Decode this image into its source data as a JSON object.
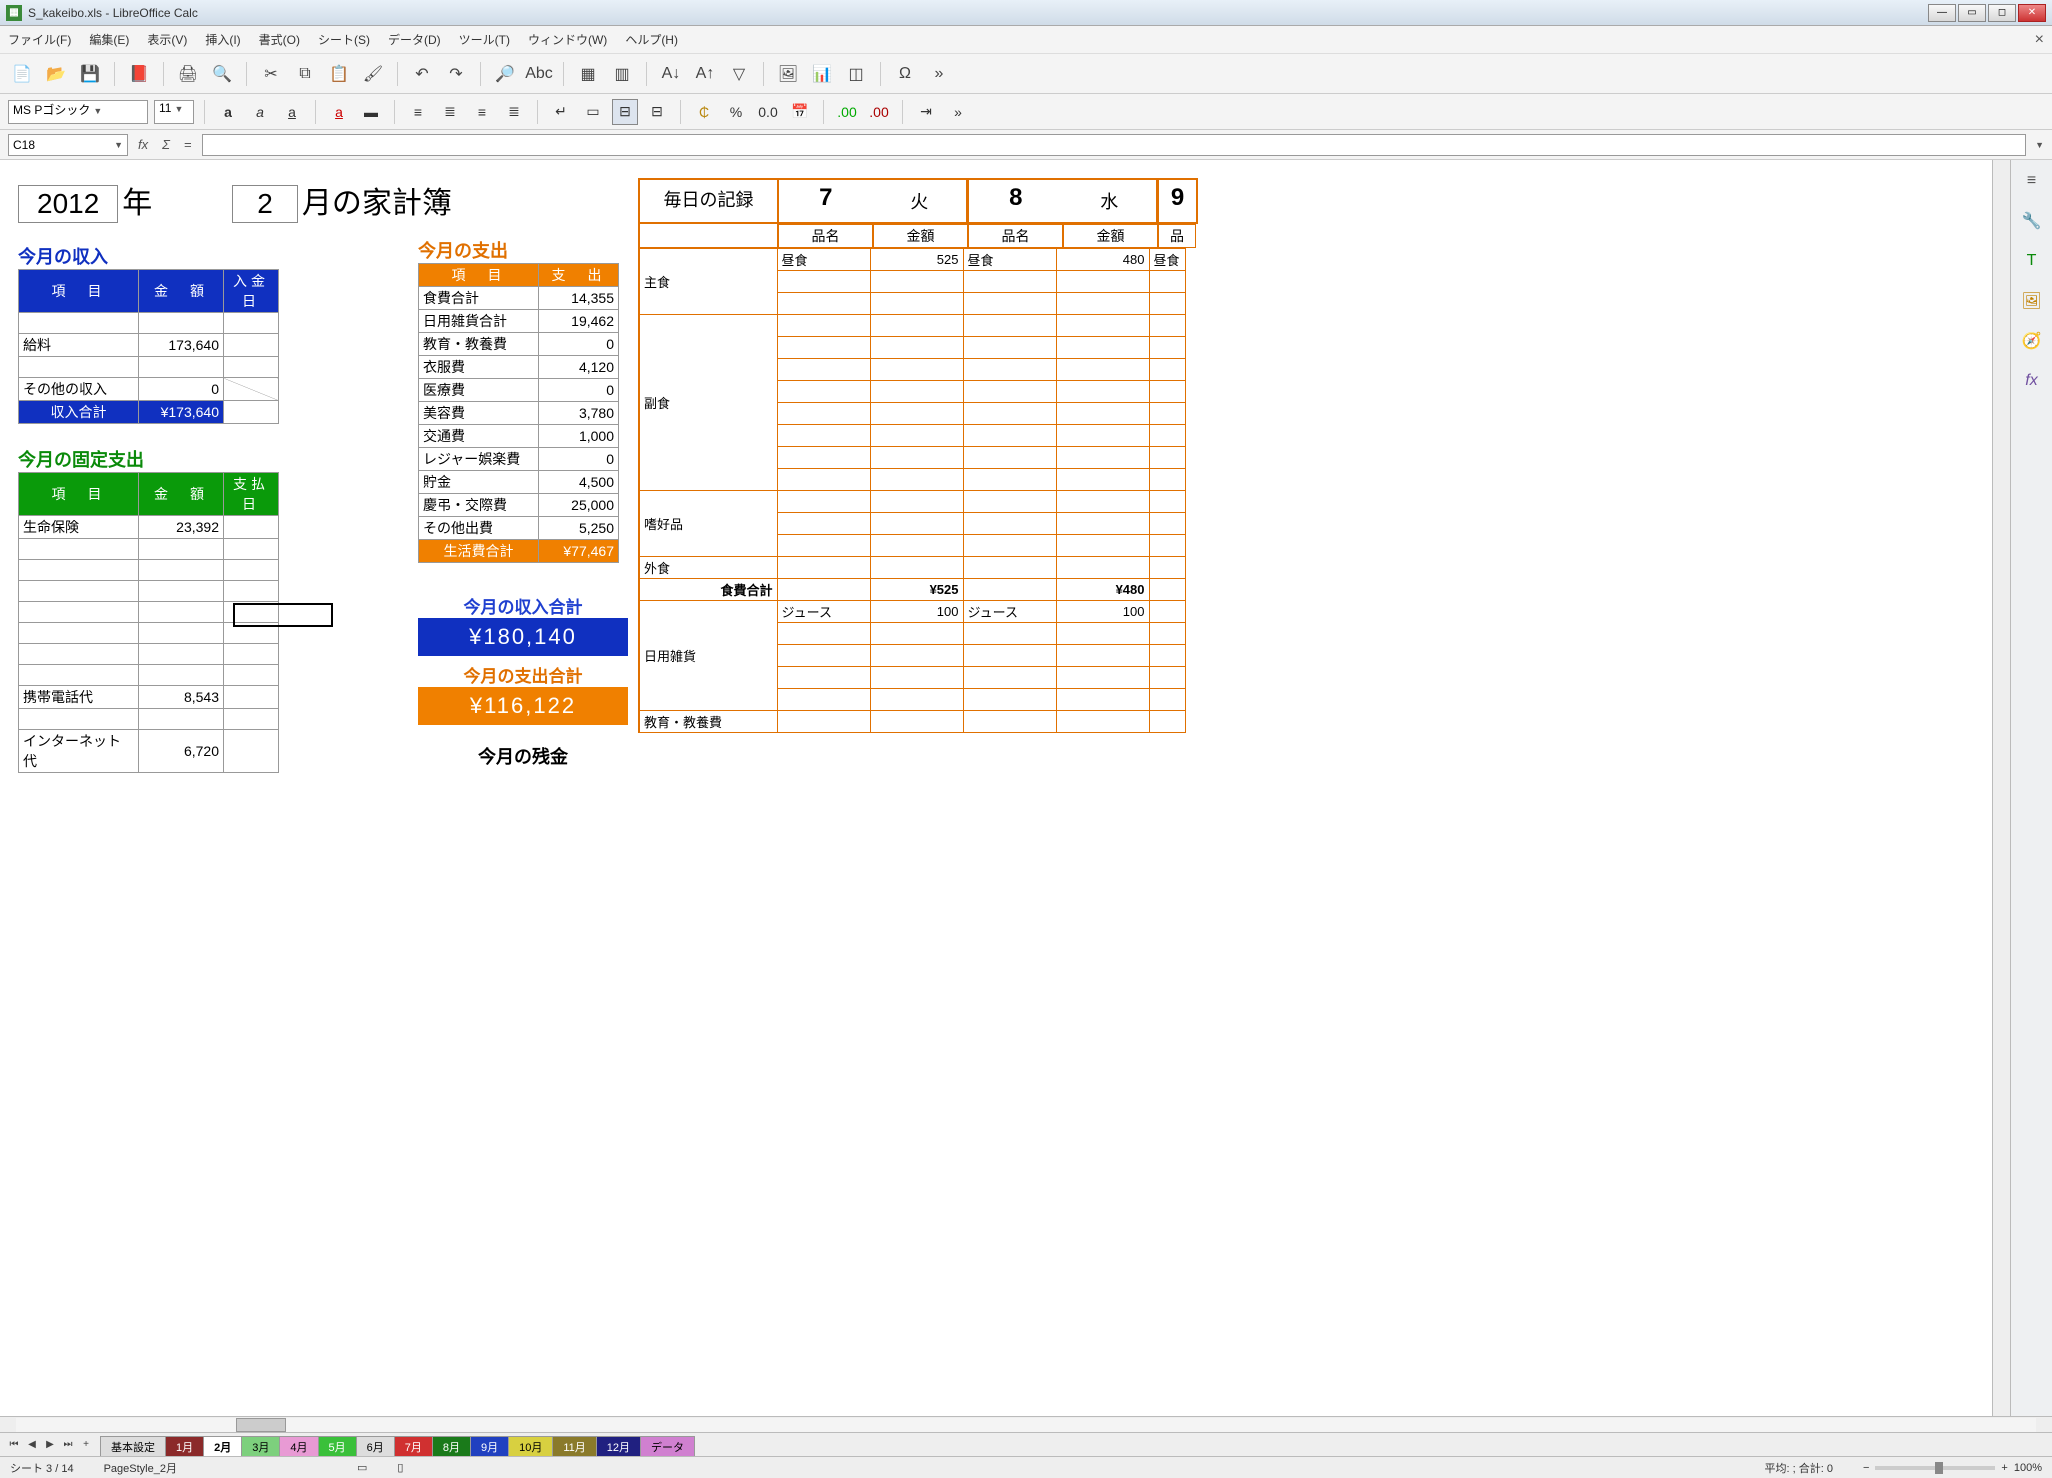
{
  "window": {
    "title": "S_kakeibo.xls - LibreOffice Calc"
  },
  "menu": {
    "file": "ファイル(F)",
    "edit": "編集(E)",
    "view": "表示(V)",
    "insert": "挿入(I)",
    "format": "書式(O)",
    "sheet": "シート(S)",
    "data": "データ(D)",
    "tools": "ツール(T)",
    "window": "ウィンドウ(W)",
    "help": "ヘルプ(H)"
  },
  "format_bar": {
    "font_name": "MS Pゴシック",
    "font_size": "11",
    "percent": "%",
    "decimal": "0.0"
  },
  "cell_ref": "C18",
  "doc": {
    "year": "2012",
    "year_suffix": "年",
    "month": "2",
    "month_suffix": "月の家計簿"
  },
  "income": {
    "title": "今月の収入",
    "headers": [
      "項　目",
      "金　額",
      "入金日"
    ],
    "rows": [
      {
        "name": "",
        "amt": "",
        "date": ""
      },
      {
        "name": "給料",
        "amt": "173,640",
        "date": ""
      },
      {
        "name": "",
        "amt": "",
        "date": ""
      },
      {
        "name": "その他の収入",
        "amt": "0",
        "date": ""
      }
    ],
    "total_label": "収入合計",
    "total_amt": "¥173,640"
  },
  "fixed": {
    "title": "今月の固定支出",
    "headers": [
      "項　目",
      "金　額",
      "支払日"
    ],
    "rows": [
      {
        "name": "生命保険",
        "amt": "23,392",
        "date": ""
      },
      {
        "name": "",
        "amt": "",
        "date": ""
      },
      {
        "name": "",
        "amt": "",
        "date": ""
      },
      {
        "name": "",
        "amt": "",
        "date": ""
      },
      {
        "name": "",
        "amt": "",
        "date": ""
      },
      {
        "name": "",
        "amt": "",
        "date": ""
      },
      {
        "name": "",
        "amt": "",
        "date": ""
      },
      {
        "name": "",
        "amt": "",
        "date": ""
      },
      {
        "name": "携帯電話代",
        "amt": "8,543",
        "date": ""
      },
      {
        "name": "",
        "amt": "",
        "date": ""
      },
      {
        "name": "インターネット代",
        "amt": "6,720",
        "date": ""
      }
    ]
  },
  "expense": {
    "title": "今月の支出",
    "headers": [
      "項　目",
      "支　出"
    ],
    "rows": [
      {
        "name": "食費合計",
        "amt": "14,355"
      },
      {
        "name": "日用雑貨合計",
        "amt": "19,462"
      },
      {
        "name": "教育・教養費",
        "amt": "0"
      },
      {
        "name": "衣服費",
        "amt": "4,120"
      },
      {
        "name": "医療費",
        "amt": "0"
      },
      {
        "name": "美容費",
        "amt": "3,780"
      },
      {
        "name": "交通費",
        "amt": "1,000"
      },
      {
        "name": "レジャー娯楽費",
        "amt": "0"
      },
      {
        "name": "貯金",
        "amt": "4,500"
      },
      {
        "name": "慶弔・交際費",
        "amt": "25,000"
      },
      {
        "name": "その他出費",
        "amt": "5,250"
      }
    ],
    "total_label": "生活費合計",
    "total_amt": "¥77,467"
  },
  "summary": {
    "income_label": "今月の収入合計",
    "income_amt": "¥180,140",
    "expense_label": "今月の支出合計",
    "expense_amt": "¥116,122",
    "balance_label": "今月の残金"
  },
  "daily": {
    "header": "毎日の記録",
    "days": [
      {
        "num": "7",
        "wday": "火"
      },
      {
        "num": "8",
        "wday": "水"
      },
      {
        "num": "9",
        "wday": ""
      }
    ],
    "sub": [
      "品名",
      "金額",
      "品名",
      "金額",
      "品"
    ],
    "categories": [
      "主食",
      "副食",
      "嗜好品",
      "外食"
    ],
    "staple_row": {
      "d1_item": "昼食",
      "d1_amt": "525",
      "d2_item": "昼食",
      "d2_amt": "480",
      "d3_item": "昼食"
    },
    "food_total": {
      "label": "食費合計",
      "d1": "¥525",
      "d2": "¥480"
    },
    "daily_goods": {
      "label": "日用雑貨",
      "d1_item": "ジュース",
      "d1_amt": "100",
      "d2_item": "ジュース",
      "d2_amt": "100"
    },
    "edu": {
      "label": "教育・教養費"
    }
  },
  "tabs": {
    "list": [
      {
        "label": "基本設定",
        "bg": "#ddd"
      },
      {
        "label": "1月",
        "bg": "#8b2a2a",
        "fg": "#fff"
      },
      {
        "label": "2月",
        "bg": "#fff",
        "active": true
      },
      {
        "label": "3月",
        "bg": "#7dd07d"
      },
      {
        "label": "4月",
        "bg": "#e89ad4"
      },
      {
        "label": "5月",
        "bg": "#3ac03a",
        "fg": "#fff"
      },
      {
        "label": "6月",
        "bg": "#ddd"
      },
      {
        "label": "7月",
        "bg": "#d03030",
        "fg": "#fff"
      },
      {
        "label": "8月",
        "bg": "#1a7a1a",
        "fg": "#fff"
      },
      {
        "label": "9月",
        "bg": "#2040c0",
        "fg": "#fff"
      },
      {
        "label": "10月",
        "bg": "#d8d040"
      },
      {
        "label": "11月",
        "bg": "#8a7a2a",
        "fg": "#fff"
      },
      {
        "label": "12月",
        "bg": "#202080",
        "fg": "#fff"
      },
      {
        "label": "データ",
        "bg": "#d080d0"
      }
    ]
  },
  "status": {
    "sheet": "シート 3 / 14",
    "pagestyle": "PageStyle_2月",
    "summary": "平均: ; 合計: 0",
    "zoom": "100%"
  }
}
